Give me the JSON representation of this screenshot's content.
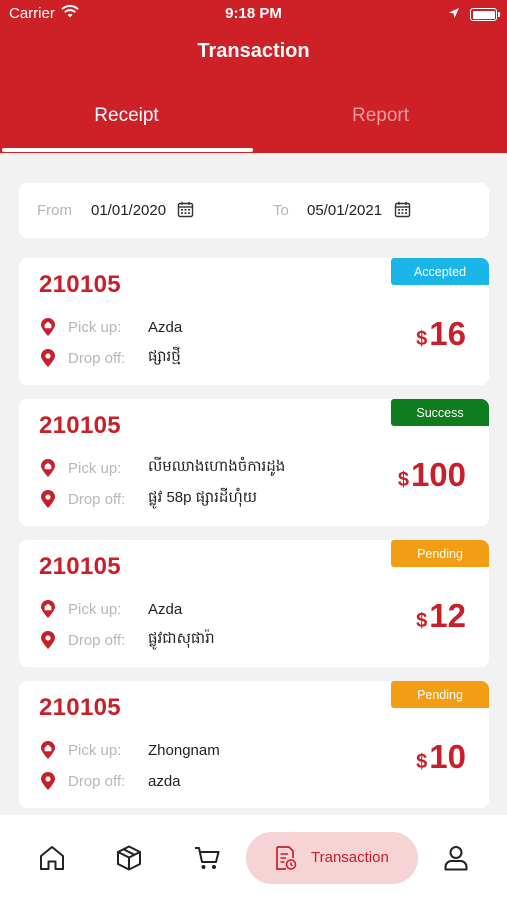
{
  "status_bar": {
    "carrier": "Carrier",
    "time": "9:18 PM"
  },
  "header": {
    "title": "Transaction"
  },
  "tabs": [
    {
      "label": "Receipt",
      "active": true
    },
    {
      "label": "Report",
      "active": false
    }
  ],
  "date_filter": {
    "from_label": "From",
    "from_value": "01/01/2020",
    "to_label": "To",
    "to_value": "05/01/2021"
  },
  "labels": {
    "pickup": "Pick up:",
    "dropoff": "Drop off:",
    "currency": "$"
  },
  "transactions": [
    {
      "id": "210105",
      "status": "Accepted",
      "status_color": "#1ab6e8",
      "pickup": "Azda",
      "dropoff": "ផ្សារថ្មី",
      "amount": "16"
    },
    {
      "id": "210105",
      "status": "Success",
      "status_color": "#0f7d1d",
      "pickup": "លីមឈាងហោងចំការដូង",
      "dropoff": "ផ្លូវ 58p ផ្សារដីហុំយ",
      "amount": "100"
    },
    {
      "id": "210105",
      "status": "Pending",
      "status_color": "#f29d14",
      "pickup": "Azda",
      "dropoff": "ផ្លូវជាសុផារ៉ា",
      "amount": "12"
    },
    {
      "id": "210105",
      "status": "Pending",
      "status_color": "#f29d14",
      "pickup": "Zhongnam",
      "dropoff": "azda",
      "amount": "10"
    }
  ],
  "bottom_nav": {
    "items": [
      {
        "icon": "home-icon"
      },
      {
        "icon": "package-icon"
      },
      {
        "icon": "cart-icon"
      },
      {
        "icon": "receipt-icon",
        "label": "Transaction",
        "active": true
      },
      {
        "icon": "user-icon"
      }
    ]
  },
  "colors": {
    "brand": "#cd2027",
    "accent_text": "#c8202a",
    "active_nav_bg": "#f6d3d4"
  }
}
